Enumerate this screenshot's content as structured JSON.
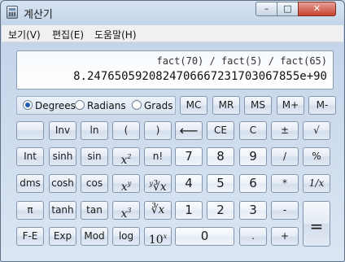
{
  "window": {
    "title": "계산기",
    "min_label": "–",
    "max_label": "□",
    "close_label": "✕"
  },
  "menu": [
    "보기(V)",
    "편집(E)",
    "도움말(H)"
  ],
  "display": {
    "expression": "fact(70) / fact(5) / fact(65)",
    "result": "8.2476505920824706667231703067855e+90"
  },
  "angle": {
    "options": [
      "Degrees",
      "Radians",
      "Grads"
    ],
    "selected": "Degrees"
  },
  "buttons": {
    "mc": "MC",
    "mr": "MR",
    "ms": "MS",
    "mplus": "M+",
    "mminus": "M-",
    "inv": "Inv",
    "ln": "ln",
    "lparen": "(",
    "rparen": ")",
    "back": "⟵",
    "ce": "CE",
    "c": "C",
    "plusminus": "±",
    "sqrt": "√",
    "int": "Int",
    "sinh": "sinh",
    "sin": "sin",
    "x2": "x",
    "x2_sup": "2",
    "nfact": "n!",
    "d7": "7",
    "d8": "8",
    "d9": "9",
    "div": "/",
    "pct": "%",
    "dms": "dms",
    "cosh": "cosh",
    "cos": "cos",
    "xy": "x",
    "xy_sup": "y",
    "yroot": "∛x",
    "yroot_sup": "y",
    "d4": "4",
    "d5": "5",
    "d6": "6",
    "mul": "*",
    "recip": "1/x",
    "pi": "π",
    "tanh": "tanh",
    "tan": "tan",
    "x3": "x",
    "x3_sup": "3",
    "cuberoot": "∛x",
    "cuberoot_sup": "3",
    "d1": "1",
    "d2": "2",
    "d3": "3",
    "sub": "-",
    "eq": "=",
    "fe": "F-E",
    "exp": "Exp",
    "mod": "Mod",
    "log": "log",
    "ten": "10",
    "ten_sup": "x",
    "d0": "0",
    "dot": ".",
    "add": "+"
  }
}
